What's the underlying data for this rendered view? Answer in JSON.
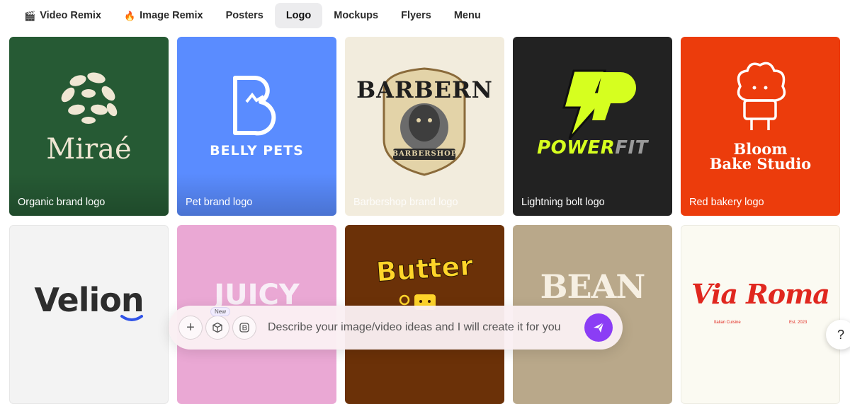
{
  "tabs": [
    {
      "label": "Video Remix",
      "icon": "clapper-icon",
      "active": false
    },
    {
      "label": "Image Remix",
      "icon": "fire-icon",
      "active": false
    },
    {
      "label": "Posters",
      "active": false
    },
    {
      "label": "Logo",
      "active": true
    },
    {
      "label": "Mockups",
      "active": false
    },
    {
      "label": "Flyers",
      "active": false
    },
    {
      "label": "Menu",
      "active": false
    }
  ],
  "cards": [
    {
      "label": "Organic brand logo",
      "brand": "Miraé",
      "bg": "#265a34"
    },
    {
      "label": "Pet brand logo",
      "brand": "BELLY PETS",
      "bg": "#5a8cff"
    },
    {
      "label": "Barbershop brand logo",
      "brand": "BARBERN",
      "sub": "BARBERSHOP",
      "bg": "#f2ecdd"
    },
    {
      "label": "Lightning bolt logo",
      "brand_a": "POWER",
      "brand_b": "FIT",
      "bg": "#222222"
    },
    {
      "label": "Red bakery logo",
      "brand": "Bloom",
      "brand2": "Bake Studio",
      "bg": "#ec3c0c"
    },
    {
      "label": "",
      "brand": "Velion",
      "bg": "#f3f3f3"
    },
    {
      "label": "",
      "brand": "JUICY",
      "bg": "#eaa8d4"
    },
    {
      "label": "",
      "brand": "Butter",
      "bg": "#6b3108"
    },
    {
      "label": "",
      "brand": "BEAN",
      "bg": "#b9a88a"
    },
    {
      "label": "",
      "brand": "Via Roma",
      "sub_left": "Italian Cuisine",
      "sub_right": "Est. 2023",
      "bg": "#fbfaf2"
    }
  ],
  "prompt": {
    "placeholder": "Describe your image/video ideas and I will create it for you",
    "new_badge": "New"
  },
  "help": "?"
}
